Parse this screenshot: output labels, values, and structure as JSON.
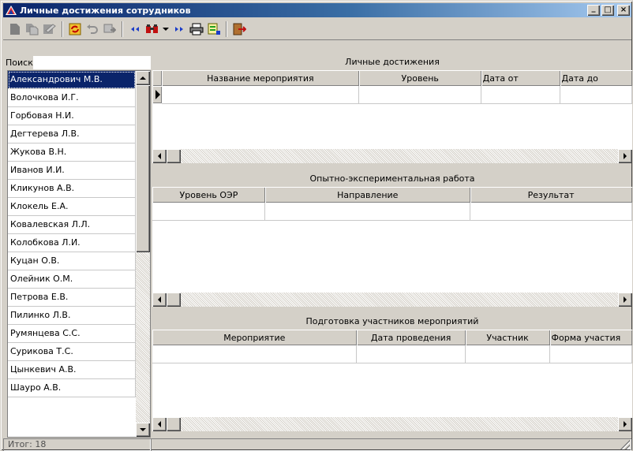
{
  "window": {
    "title": "Личные достижения сотрудников",
    "minimize": "_",
    "maximize": "□",
    "close": "×"
  },
  "toolbar": {
    "items": [
      "new-document-icon",
      "copy-document-icon",
      "edit-document-icon",
      "refresh-icon",
      "undo-icon",
      "export-icon",
      "prev-icon",
      "find-icon",
      "find-dropdown-icon",
      "next-icon",
      "print-icon",
      "preview-icon",
      "exit-icon"
    ]
  },
  "left": {
    "search_label": "Поиск",
    "search_value": "",
    "employees": [
      "Александрович М.В.",
      "Волочкова И.Г.",
      "Горбовая Н.И.",
      "Дегтерева Л.В.",
      "Жукова В.Н.",
      "Иванов И.И.",
      "Кликунов А.В.",
      "Клокель Е.А.",
      "Ковалевская Л.Л.",
      "Колобкова Л.И.",
      "Куцан О.В.",
      "Олейник О.М.",
      "Петрова Е.В.",
      "Пилинко Л.В.",
      "Румянцева С.С.",
      "Сурикова Т.С.",
      "Цынкевич А.В.",
      "Шауро А.В."
    ],
    "selected_index": 0
  },
  "sections": {
    "achievements": {
      "title": "Личные достижения",
      "columns": [
        "Название мероприятия",
        "Уровень",
        "Дата от",
        "Дата до"
      ]
    },
    "research": {
      "title": "Опытно-экспериментальная работа",
      "columns": [
        "Уровень ОЭР",
        "Направление",
        "Результат"
      ]
    },
    "training": {
      "title": "Подготовка участников мероприятий",
      "columns": [
        "Мероприятие",
        "Дата проведения",
        "Участник",
        "Форма участия"
      ]
    }
  },
  "status": {
    "total": "Итог:  18"
  },
  "colors": {
    "title_start": "#0a246a",
    "title_end": "#a6caf0",
    "face": "#d4d0c8",
    "selection": "#0a246a"
  }
}
